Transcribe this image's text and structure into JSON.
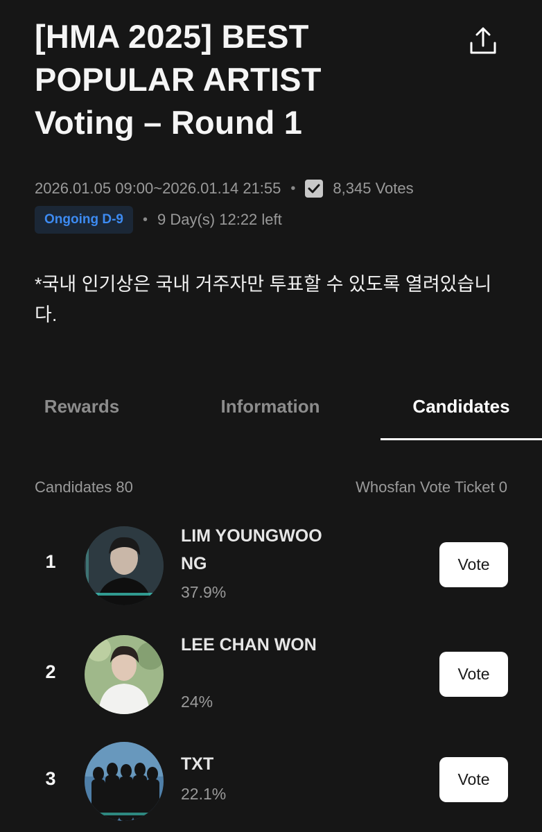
{
  "header": {
    "title_line1": "[HMA 2025] BEST",
    "title_line2": "POPULAR ARTIST",
    "title_line3": "Voting – Round 1",
    "share_icon": "share-icon"
  },
  "meta": {
    "period": "2026.01.05 09:00~2026.01.14 21:55",
    "separator": "•",
    "votes": "8,345 Votes",
    "status_badge": "Ongoing D-9",
    "time_left": "9 Day(s) 12:22 left"
  },
  "notice": "*국내 인기상은 국내 거주자만 투표할 수 있도록 열려있습니다.",
  "tabs": [
    {
      "label": "Rewards",
      "active": false
    },
    {
      "label": "Information",
      "active": false
    },
    {
      "label": "Candidates",
      "active": true
    }
  ],
  "candidates_header": {
    "count_label": "Candidates 80",
    "ticket_label": "Whosfan Vote Ticket 0"
  },
  "candidates": [
    {
      "rank": "1",
      "name": "LIM YOUNGWOONG",
      "percent": "37.9%",
      "vote_label": "Vote"
    },
    {
      "rank": "2",
      "name": "LEE CHAN WON",
      "percent": "24%",
      "vote_label": "Vote"
    },
    {
      "rank": "3",
      "name": "TXT",
      "percent": "22.1%",
      "vote_label": "Vote"
    }
  ],
  "colors": {
    "background": "#161616",
    "badge_text": "#3d8bf2",
    "badge_bg": "#1b2736",
    "button_bg": "#ffffff"
  }
}
